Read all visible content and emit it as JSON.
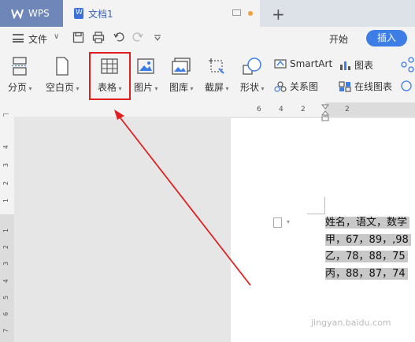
{
  "titlebar": {
    "app_tab": "WPS",
    "doc_tab": "文档1"
  },
  "menu": {
    "file_label": "文件",
    "start_tab": "开始",
    "insert_tab": "插入"
  },
  "ribbon": {
    "items": [
      {
        "label": "分页",
        "icon": "page-break-icon"
      },
      {
        "label": "空白页",
        "icon": "blank-page-icon"
      },
      {
        "label": "表格",
        "icon": "table-icon"
      },
      {
        "label": "图片",
        "icon": "picture-icon"
      },
      {
        "label": "图库",
        "icon": "gallery-icon"
      },
      {
        "label": "截屏",
        "icon": "screenshot-icon"
      },
      {
        "label": "形状",
        "icon": "shape-icon"
      }
    ],
    "smartart": "SmartArt",
    "chart": "图表",
    "relation": "关系图",
    "online_chart": "在线图表"
  },
  "ruler": {
    "h_ticks": [
      "6",
      "4",
      "2",
      "2"
    ],
    "v_ticks": [
      "4",
      "3",
      "2",
      "1",
      "1",
      "2",
      "3",
      "4",
      "5",
      "6",
      "7"
    ]
  },
  "document": {
    "lines": [
      "姓名，语文，数学",
      "甲，67，89，,98",
      "乙，78，88，75",
      "丙，88，87，74"
    ]
  },
  "watermark": "jingyan.baidu.com",
  "colors": {
    "accent": "#3d7de6",
    "annotation_red": "#e02020"
  }
}
